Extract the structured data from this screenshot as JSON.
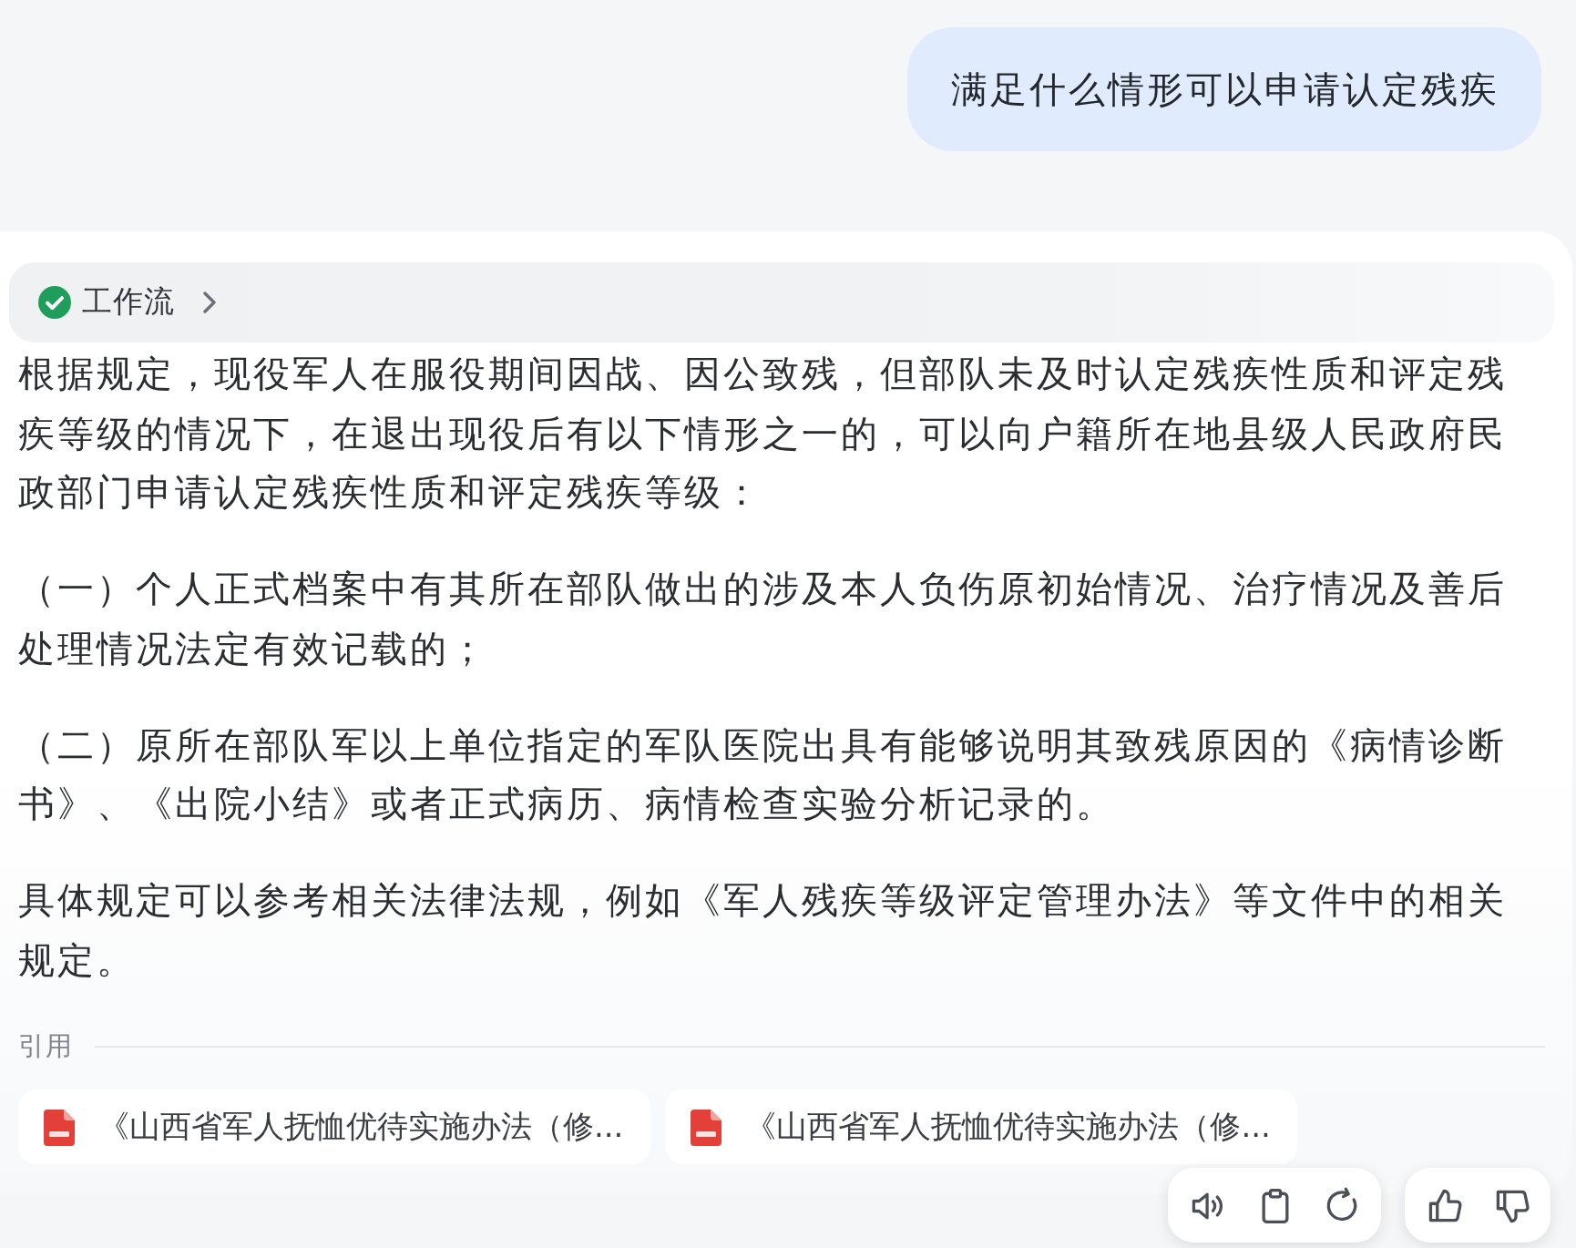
{
  "user_message": {
    "text": "满足什么情形可以申请认定残疾"
  },
  "answer": {
    "workflow": {
      "label": "工作流",
      "completed": true,
      "expanded": false
    },
    "paragraphs": [
      "根据规定，现役军人在服役期间因战、因公致残，但部队未及时认定残疾性质和评定残疾等级的情况下，在退出现役后有以下情形之一的，可以向户籍所在地县级人民政府民政部门申请认定残疾性质和评定残疾等级：",
      "（一）个人正式档案中有其所在部队做出的涉及本人负伤原初始情况、治疗情况及善后处理情况法定有效记载的；",
      "（二）原所在部队军以上单位指定的军队医院出具有能够说明其致残原因的《病情诊断书》、《出院小结》或者正式病历、病情检查实验分析记录的。",
      "具体规定可以参考相关法律法规，例如《军人残疾等级评定管理办法》等文件中的相关规定。"
    ],
    "references": {
      "label": "引用",
      "items": [
        {
          "title": "《山西省军人抚恤优待实施办法（修..."
        },
        {
          "title": "《山西省军人抚恤优待实施办法（修..."
        }
      ]
    }
  }
}
